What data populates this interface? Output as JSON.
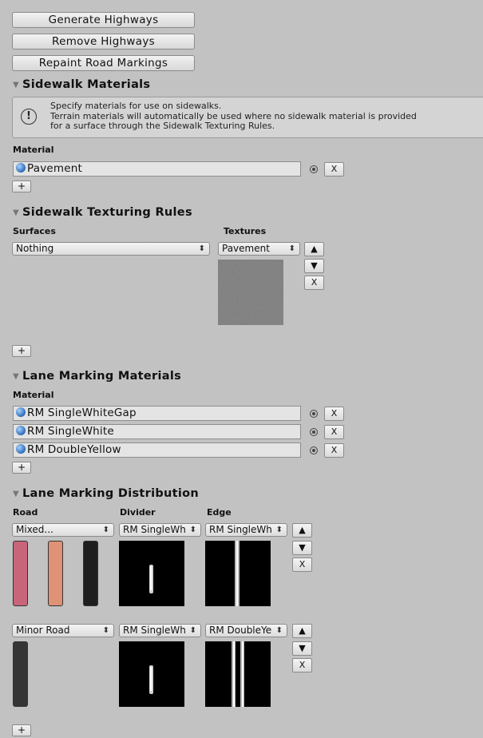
{
  "buttons": {
    "generate": "Generate Highways",
    "remove": "Remove Highways",
    "repaint": "Repaint Road Markings"
  },
  "sidewalk_materials": {
    "title": "Sidewalk Materials",
    "help_lines": [
      "Specify materials for use on sidewalks.",
      "Terrain materials will automatically be used where no sidewalk material is provided",
      "for a surface through the Sidewalk Texturing Rules."
    ],
    "material_label": "Material",
    "materials": [
      "Pavement"
    ],
    "add_label": "+",
    "remove_label": "X"
  },
  "sidewalk_texturing": {
    "title": "Sidewalk Texturing Rules",
    "surfaces_label": "Surfaces",
    "textures_label": "Textures",
    "surface_value": "Nothing",
    "texture_value": "Pavement",
    "up_label": "▲",
    "down_label": "▼",
    "remove_label": "X",
    "add_label": "+"
  },
  "lane_materials": {
    "title": "Lane Marking Materials",
    "material_label": "Material",
    "materials": [
      "RM SingleWhiteGap",
      "RM SingleWhite",
      "RM DoubleYellow"
    ],
    "remove_label": "X",
    "add_label": "+"
  },
  "lane_distribution": {
    "title": "Lane Marking Distribution",
    "road_label": "Road",
    "divider_label": "Divider",
    "edge_label": "Edge",
    "rows": [
      {
        "road": "Mixed...",
        "divider": "RM SingleWh",
        "edge": "RM SingleWh",
        "swatch_colors": [
          "#c9657a",
          "#e09276",
          "#1e1e1e"
        ]
      },
      {
        "road": "Minor Road",
        "divider": "RM SingleWh",
        "edge": "RM DoubleYe",
        "swatch_colors": [
          "#353535"
        ]
      }
    ],
    "up_label": "▲",
    "down_label": "▼",
    "remove_label": "X",
    "add_label": "+"
  },
  "icons": {
    "help": "info-icon",
    "material": "material-sphere-icon",
    "picker": "object-picker-icon",
    "foldout": "foldout-triangle-icon"
  }
}
